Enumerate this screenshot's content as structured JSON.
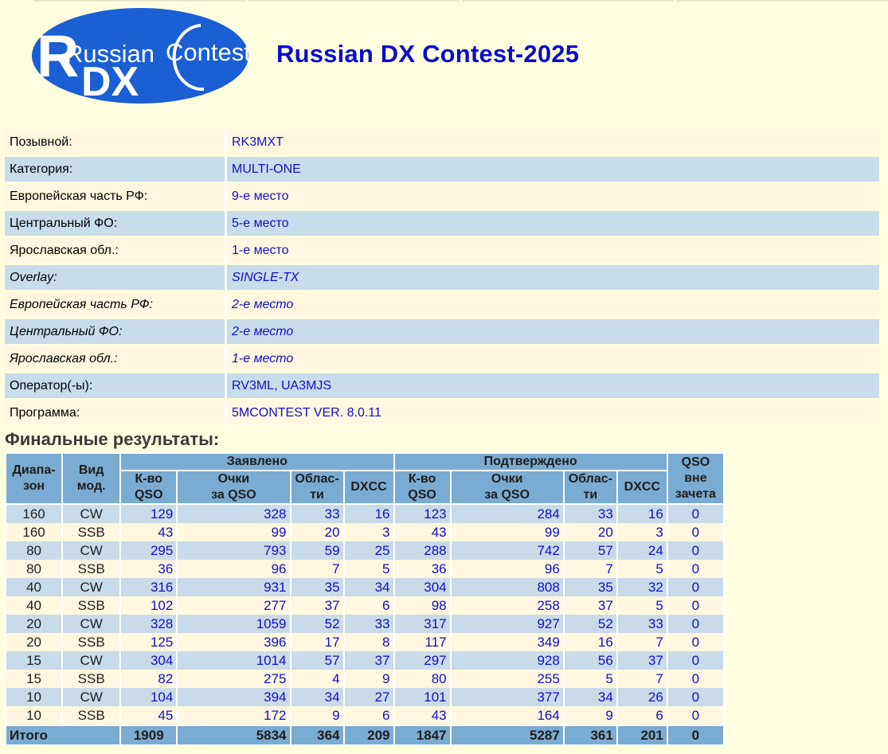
{
  "logo": {
    "word_russian": "Russian",
    "word_contest": "Contest",
    "letter_r": "R",
    "letters_dx": "DX"
  },
  "page_title": "Russian DX Contest-2025",
  "info": [
    {
      "label": "Позывной:",
      "value": "RK3MXT",
      "italic": false
    },
    {
      "label": "Категория:",
      "value": "MULTI-ONE",
      "italic": false
    },
    {
      "label": "Европейская часть РФ:",
      "value": "9-е место",
      "italic": false
    },
    {
      "label": "Центральный ФО:",
      "value": "5-е место",
      "italic": false
    },
    {
      "label": "Ярославская обл.:",
      "value": "1-е место",
      "italic": false
    },
    {
      "label": "Overlay:",
      "value": "SINGLE-TX",
      "italic": true
    },
    {
      "label": "Европейская часть РФ:",
      "value": "2-е место",
      "italic": true
    },
    {
      "label": "Центральный ФО:",
      "value": "2-е место",
      "italic": true
    },
    {
      "label": "Ярославская обл.:",
      "value": "1-е место",
      "italic": true
    },
    {
      "label": "Оператор(-ы):",
      "value": "RV3ML, UA3MJS",
      "italic": false
    },
    {
      "label": "Программа:",
      "value": "5MCONTEST VER. 8.0.11",
      "italic": false
    }
  ],
  "results": {
    "heading": "Финальные результаты:",
    "header": {
      "band": "Диапа-\nзон",
      "mode": "Вид\nмод.",
      "claimed": "Заявлено",
      "confirmed": "Подтверждено",
      "out_of_score": "QSO\nвне\nзачета",
      "qso": "К-во\nQSO",
      "points": "Очки\nза QSO",
      "regions": "Облас-\nти",
      "dxcc": "DXCC"
    },
    "rows": [
      [
        "160",
        "CW",
        "129",
        "328",
        "33",
        "16",
        "123",
        "284",
        "33",
        "16",
        "0"
      ],
      [
        "160",
        "SSB",
        "43",
        "99",
        "20",
        "3",
        "43",
        "99",
        "20",
        "3",
        "0"
      ],
      [
        "80",
        "CW",
        "295",
        "793",
        "59",
        "25",
        "288",
        "742",
        "57",
        "24",
        "0"
      ],
      [
        "80",
        "SSB",
        "36",
        "96",
        "7",
        "5",
        "36",
        "96",
        "7",
        "5",
        "0"
      ],
      [
        "40",
        "CW",
        "316",
        "931",
        "35",
        "34",
        "304",
        "808",
        "35",
        "32",
        "0"
      ],
      [
        "40",
        "SSB",
        "102",
        "277",
        "37",
        "6",
        "98",
        "258",
        "37",
        "5",
        "0"
      ],
      [
        "20",
        "CW",
        "328",
        "1059",
        "52",
        "33",
        "317",
        "927",
        "52",
        "33",
        "0"
      ],
      [
        "20",
        "SSB",
        "125",
        "396",
        "17",
        "8",
        "117",
        "349",
        "16",
        "7",
        "0"
      ],
      [
        "15",
        "CW",
        "304",
        "1014",
        "57",
        "37",
        "297",
        "928",
        "56",
        "37",
        "0"
      ],
      [
        "15",
        "SSB",
        "82",
        "275",
        "4",
        "9",
        "80",
        "255",
        "5",
        "7",
        "0"
      ],
      [
        "10",
        "CW",
        "104",
        "394",
        "34",
        "27",
        "101",
        "377",
        "34",
        "26",
        "0"
      ],
      [
        "10",
        "SSB",
        "45",
        "172",
        "9",
        "6",
        "43",
        "164",
        "9",
        "6",
        "0"
      ]
    ],
    "total": [
      "Итого",
      "1909",
      "5834",
      "364",
      "209",
      "1847",
      "5287",
      "361",
      "201",
      "0"
    ]
  },
  "colors": {
    "background": "#ffffe0",
    "title_blue": "#0b0bcc",
    "value_blue": "#1010c8",
    "header_blue": "#7aabd2",
    "row_blue": "#c9dbe8",
    "row_cream": "#fff7df",
    "logo_blue": "#1a5fd4"
  }
}
